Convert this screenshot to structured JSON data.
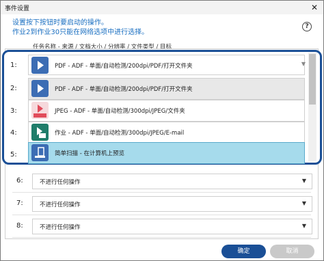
{
  "window": {
    "title": "事件设置",
    "close_glyph": "✕"
  },
  "instructions": {
    "line1": "设置按下按钮时要启动的操作。",
    "line2": "作业2到作业30只能在网络选项中进行选择。"
  },
  "help_glyph": "?",
  "list_header": "任务名称 - 来源 / 文档大小 / 分辨率 / 文件类型 / 目标",
  "selected_row": {
    "num": "1:",
    "value": "PDF - ADF - 单面/自动检测/200dpi/PDF/打开文件夹"
  },
  "dropdown_items": [
    {
      "num": "2:",
      "label": "PDF - ADF - 单面/自动检测/200dpi/PDF/打开文件夹",
      "icon": "pdf-folder-icon"
    },
    {
      "num": "3:",
      "label": "JPEG - ADF - 单面/自动检测/300dpi/JPEG/文件夹",
      "icon": "jpeg-icon"
    },
    {
      "num": "4:",
      "label": "作业 - ADF - 单面/自动检测/300dpi/JPEG/E-mail",
      "icon": "email-icon"
    },
    {
      "num": "5:",
      "label": "简单扫描 - 在计算机上预览",
      "icon": "scan-preview-icon"
    }
  ],
  "rows": [
    {
      "num": "6:",
      "value": "不进行任何操作"
    },
    {
      "num": "7:",
      "value": "不进行任何操作"
    },
    {
      "num": "8:",
      "value": "不进行任何操作"
    }
  ],
  "buttons": {
    "ok": "确定",
    "cancel": "取消"
  },
  "colors": {
    "accent": "#1a4f96",
    "link": "#1a6fc1",
    "highlight": "#a6dbec"
  }
}
